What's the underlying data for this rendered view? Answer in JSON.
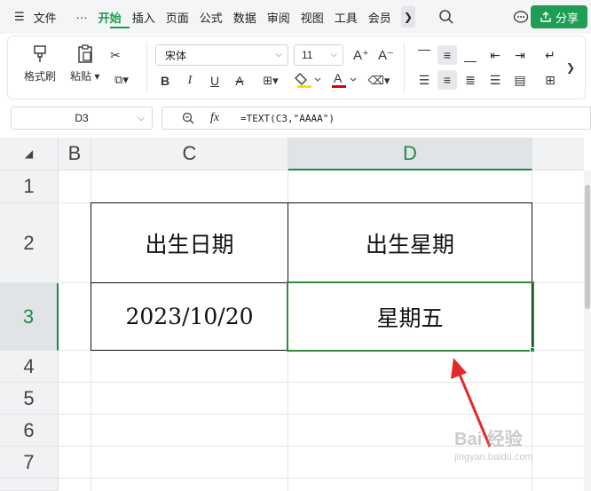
{
  "menubar": {
    "file_menu": "文件",
    "more": "···",
    "tabs": [
      "开始",
      "插入",
      "页面",
      "公式",
      "数据",
      "审阅",
      "视图",
      "工具",
      "会员"
    ],
    "active_tab": "开始",
    "share": "分享"
  },
  "toolbar": {
    "format_painter": "格式刷",
    "paste": "粘贴",
    "font_name": "宋体",
    "font_size": "11",
    "bold": "B",
    "italic": "I",
    "underline": "U",
    "strike": "A",
    "colors": {
      "highlight": "#f5e400",
      "font_color": "#e00000"
    }
  },
  "formula_bar": {
    "name_box": "D3",
    "fx": "fx",
    "formula": "=TEXT(C3,\"AAAA\")"
  },
  "sheet": {
    "columns": [
      "B",
      "C",
      "D"
    ],
    "selected_column": "D",
    "rows": [
      "1",
      "2",
      "3",
      "4",
      "5",
      "6",
      "7"
    ],
    "selected_row": "3",
    "cells": {
      "C2": "出生日期",
      "D2": "出生星期",
      "C3": "2023/10/20",
      "D3": "星期五"
    },
    "selection_color": "#2e8b3e"
  },
  "watermark": {
    "main": "Bai 经验",
    "sub": "jingyan.baidu.com"
  }
}
